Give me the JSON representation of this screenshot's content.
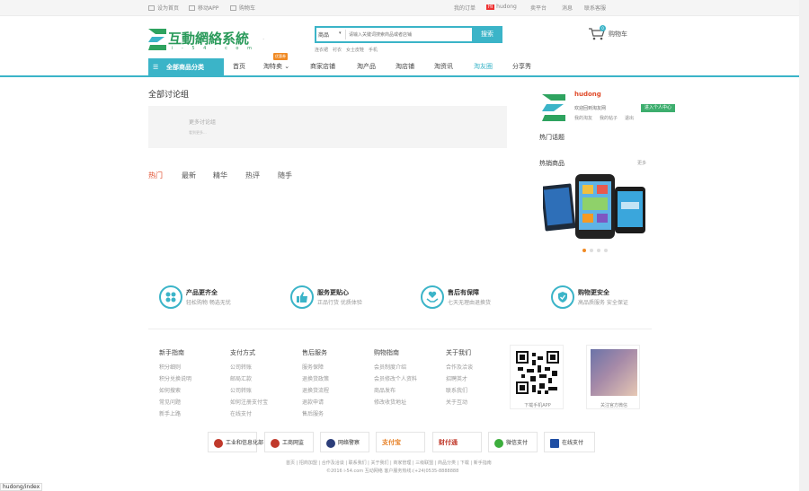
{
  "topbar": {
    "left": [
      {
        "label": "设为首页",
        "icon": "home-icon"
      },
      {
        "label": "移动APP",
        "icon": "phone-icon"
      },
      {
        "label": "购物车",
        "icon": "cart-icon"
      }
    ],
    "right": [
      "我的订单",
      "hudong",
      "卖平台",
      "消息",
      "联系客服"
    ]
  },
  "logo": {
    "title": "互動網絡系統",
    "subtitle": "i - 5 4 . c o m"
  },
  "search": {
    "category": "商品",
    "placeholder": "请输入关键词搜索商品或者店铺",
    "button": "搜索",
    "hotwords": [
      "连衣裙",
      "衬衣",
      "女士皮鞋",
      "手机"
    ]
  },
  "cart": {
    "label": "购物车",
    "count": "0"
  },
  "nav": {
    "category_button": "全部商品分类",
    "items": [
      "首页",
      "淘特卖",
      "商家店铺",
      "淘产品",
      "淘店铺",
      "淘资讯",
      "淘友圈",
      "分享秀"
    ],
    "badge": "优惠券",
    "active_index": 6
  },
  "main": {
    "title": "全部讨论组",
    "discuss_more": "更多讨论组",
    "discuss_sub": "看到更多...",
    "tabs": [
      "热门",
      "最新",
      "精华",
      "热评",
      "随手"
    ]
  },
  "sidebar": {
    "user_name": "hudong",
    "center_button": "进入个人中心",
    "welcome": "欢迎回到淘友网",
    "links": [
      "我的淘友",
      "我的帖子",
      "退出"
    ],
    "hot_topics": "热门话题",
    "hot_products": "热销商品",
    "more": "更多"
  },
  "features": [
    {
      "title": "产品更齐全",
      "sub": "轻松购物 畅选无忧",
      "icon": "grid-icon"
    },
    {
      "title": "服务更贴心",
      "sub": "正品行货 优质体验",
      "icon": "thumbs-up-icon"
    },
    {
      "title": "售后有保障",
      "sub": "七天无理由退换货",
      "icon": "heart-hands-icon"
    },
    {
      "title": "购物更安全",
      "sub": "高品质服务 安全保证",
      "icon": "shield-icon"
    }
  ],
  "footer_columns": [
    {
      "title": "新手指南",
      "links": [
        "积分细则",
        "积分兑换说明",
        "如何搜索",
        "常见问题",
        "新手上路"
      ]
    },
    {
      "title": "支付方式",
      "links": [
        "公司转账",
        "邮局汇款",
        "公司转账",
        "如何注册支付宝",
        "在线支付"
      ]
    },
    {
      "title": "售后服务",
      "links": [
        "服务保障",
        "退换货政策",
        "退换货流程",
        "退款申请",
        "售后服务"
      ]
    },
    {
      "title": "购物指南",
      "links": [
        "会员制度介绍",
        "会员修改个人资料",
        "商品发布",
        "修改收货地址"
      ]
    },
    {
      "title": "关于我们",
      "links": [
        "合作及洽谈",
        "招聘英才",
        "联系我们",
        "关于互动"
      ]
    }
  ],
  "qr": {
    "app_caption": "下载手机APP",
    "wechat_caption": "关注官方微信"
  },
  "certs": [
    {
      "label": "工业和信息化部",
      "color": "#c0392b"
    },
    {
      "label": "工商网监",
      "color": "#c0392b"
    },
    {
      "label": "网络警察",
      "color": "#2c3e7a"
    },
    {
      "label": "支付宝",
      "color": "#e67e22"
    },
    {
      "label": "财付通",
      "color": "#c0392b"
    },
    {
      "label": "微信支付",
      "color": "#3dae3d"
    },
    {
      "label": "在线支付",
      "color": "#1f4ea3"
    }
  ],
  "footer_links": "首页 | 招商加盟 | 合作及洽谈 | 联系我们 | 关于我们 | 商家管理 | 三级联盟 | 商品分类 | 下载 | 新手指南",
  "copyright": "©2016 i-54.com 互动网络 客户服务热线:(+24)0535-8888888",
  "status_text": "hudong/index"
}
